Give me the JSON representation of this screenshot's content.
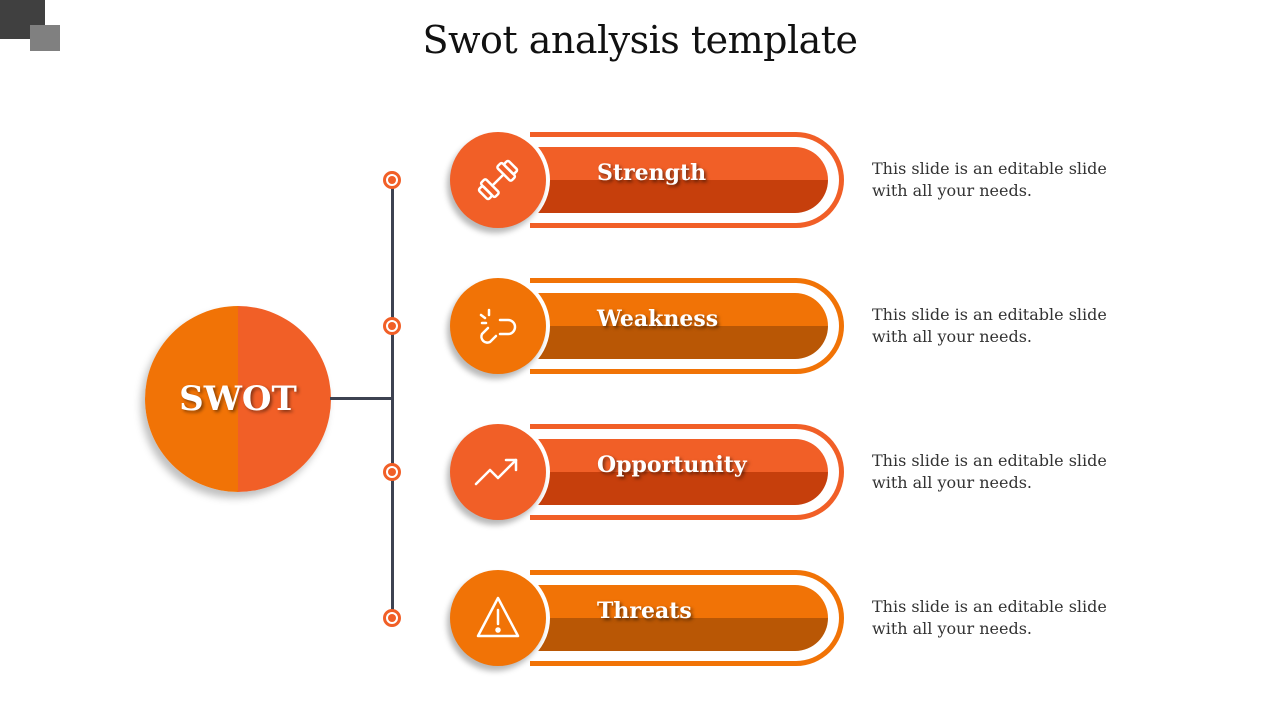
{
  "title": "Swot analysis template",
  "center": {
    "label": "SWOT",
    "colors": {
      "left": "#f17306",
      "right": "#f15f27"
    }
  },
  "items": [
    {
      "label": "Strength",
      "icon": "dumbbell-icon",
      "accent": "#f15f27",
      "dark": "#c63f0c",
      "description": "This slide is an editable slide with all your needs."
    },
    {
      "label": "Weakness",
      "icon": "broken-link-icon",
      "accent": "#f17306",
      "dark": "#b95705",
      "description": "This slide is an editable slide with all your needs."
    },
    {
      "label": "Opportunity",
      "icon": "trending-up-icon",
      "accent": "#f15f27",
      "dark": "#c63f0c",
      "description": "This slide is an editable slide with all your needs."
    },
    {
      "label": "Threats",
      "icon": "warning-icon",
      "accent": "#f17306",
      "dark": "#b95705",
      "description": "This slide is an editable slide with all your needs."
    }
  ]
}
